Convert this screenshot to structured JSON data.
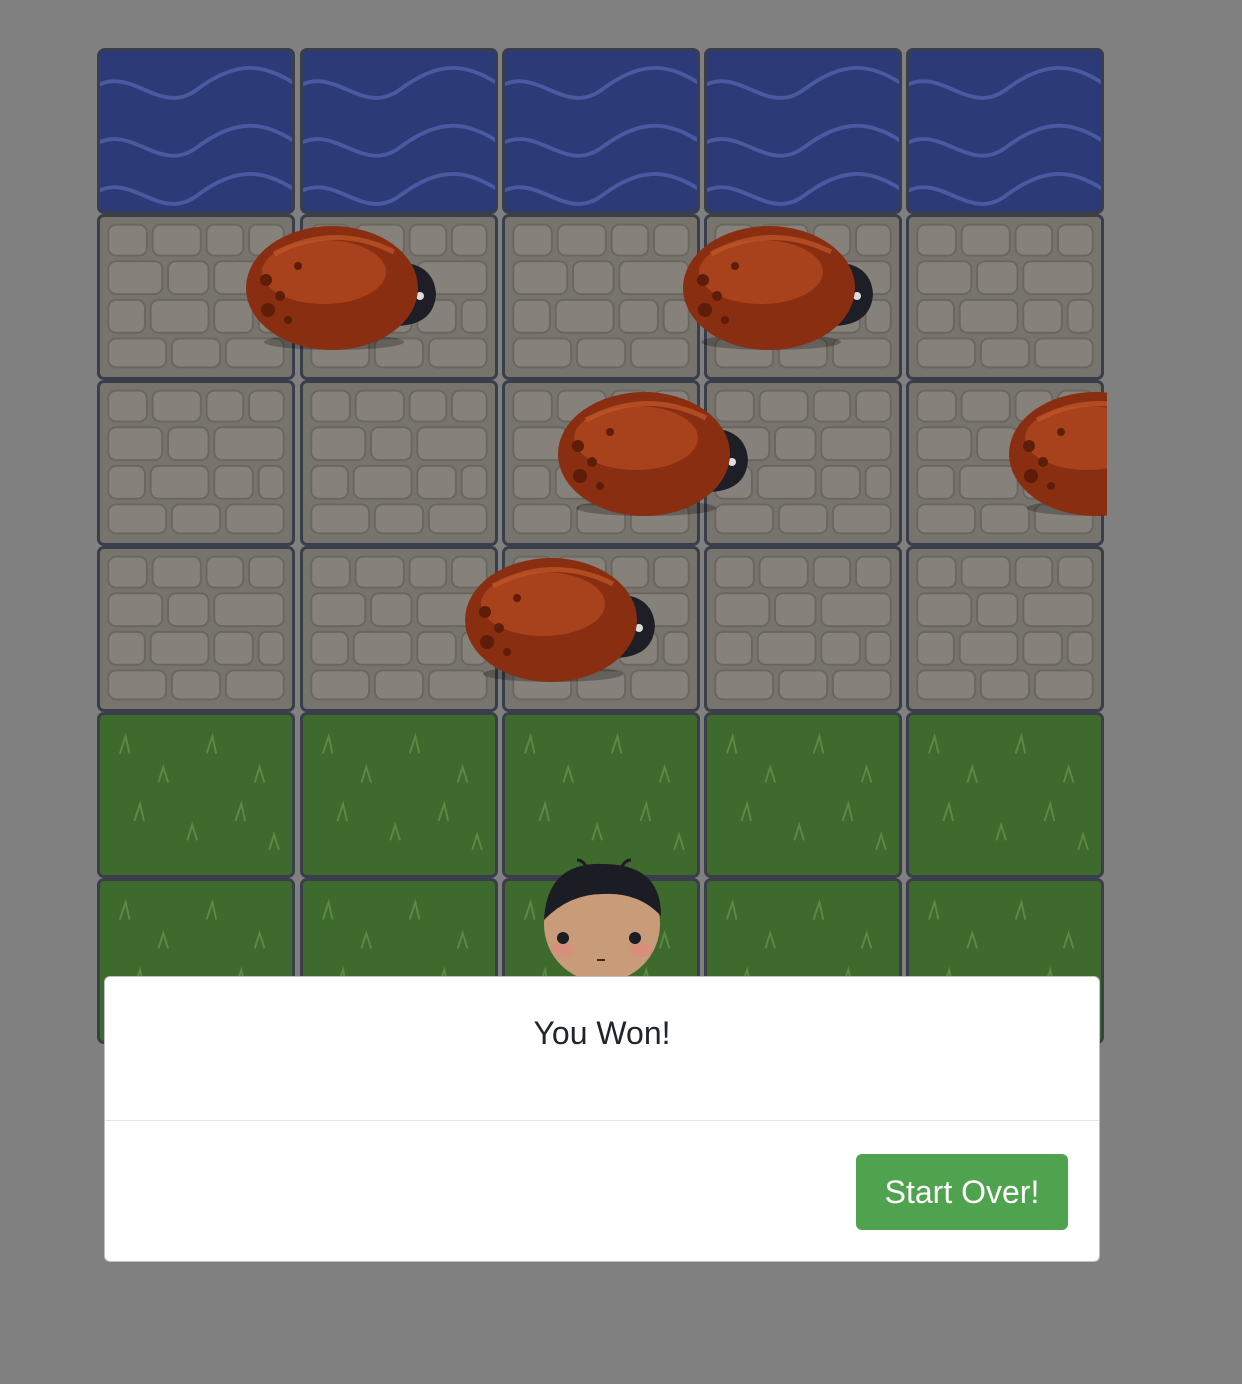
{
  "modal": {
    "message": "You Won!",
    "button_label": "Start Over!"
  },
  "board": {
    "columns": 5,
    "rows": [
      "water",
      "stone",
      "stone",
      "stone",
      "grass",
      "grass"
    ]
  },
  "colors": {
    "water": "#2c3a78",
    "stone": "#77736d",
    "grass": "#3e6a2e",
    "enemy_bug": "#8a2e12",
    "button": "#4fa34f",
    "overlay_background": "#808080"
  }
}
